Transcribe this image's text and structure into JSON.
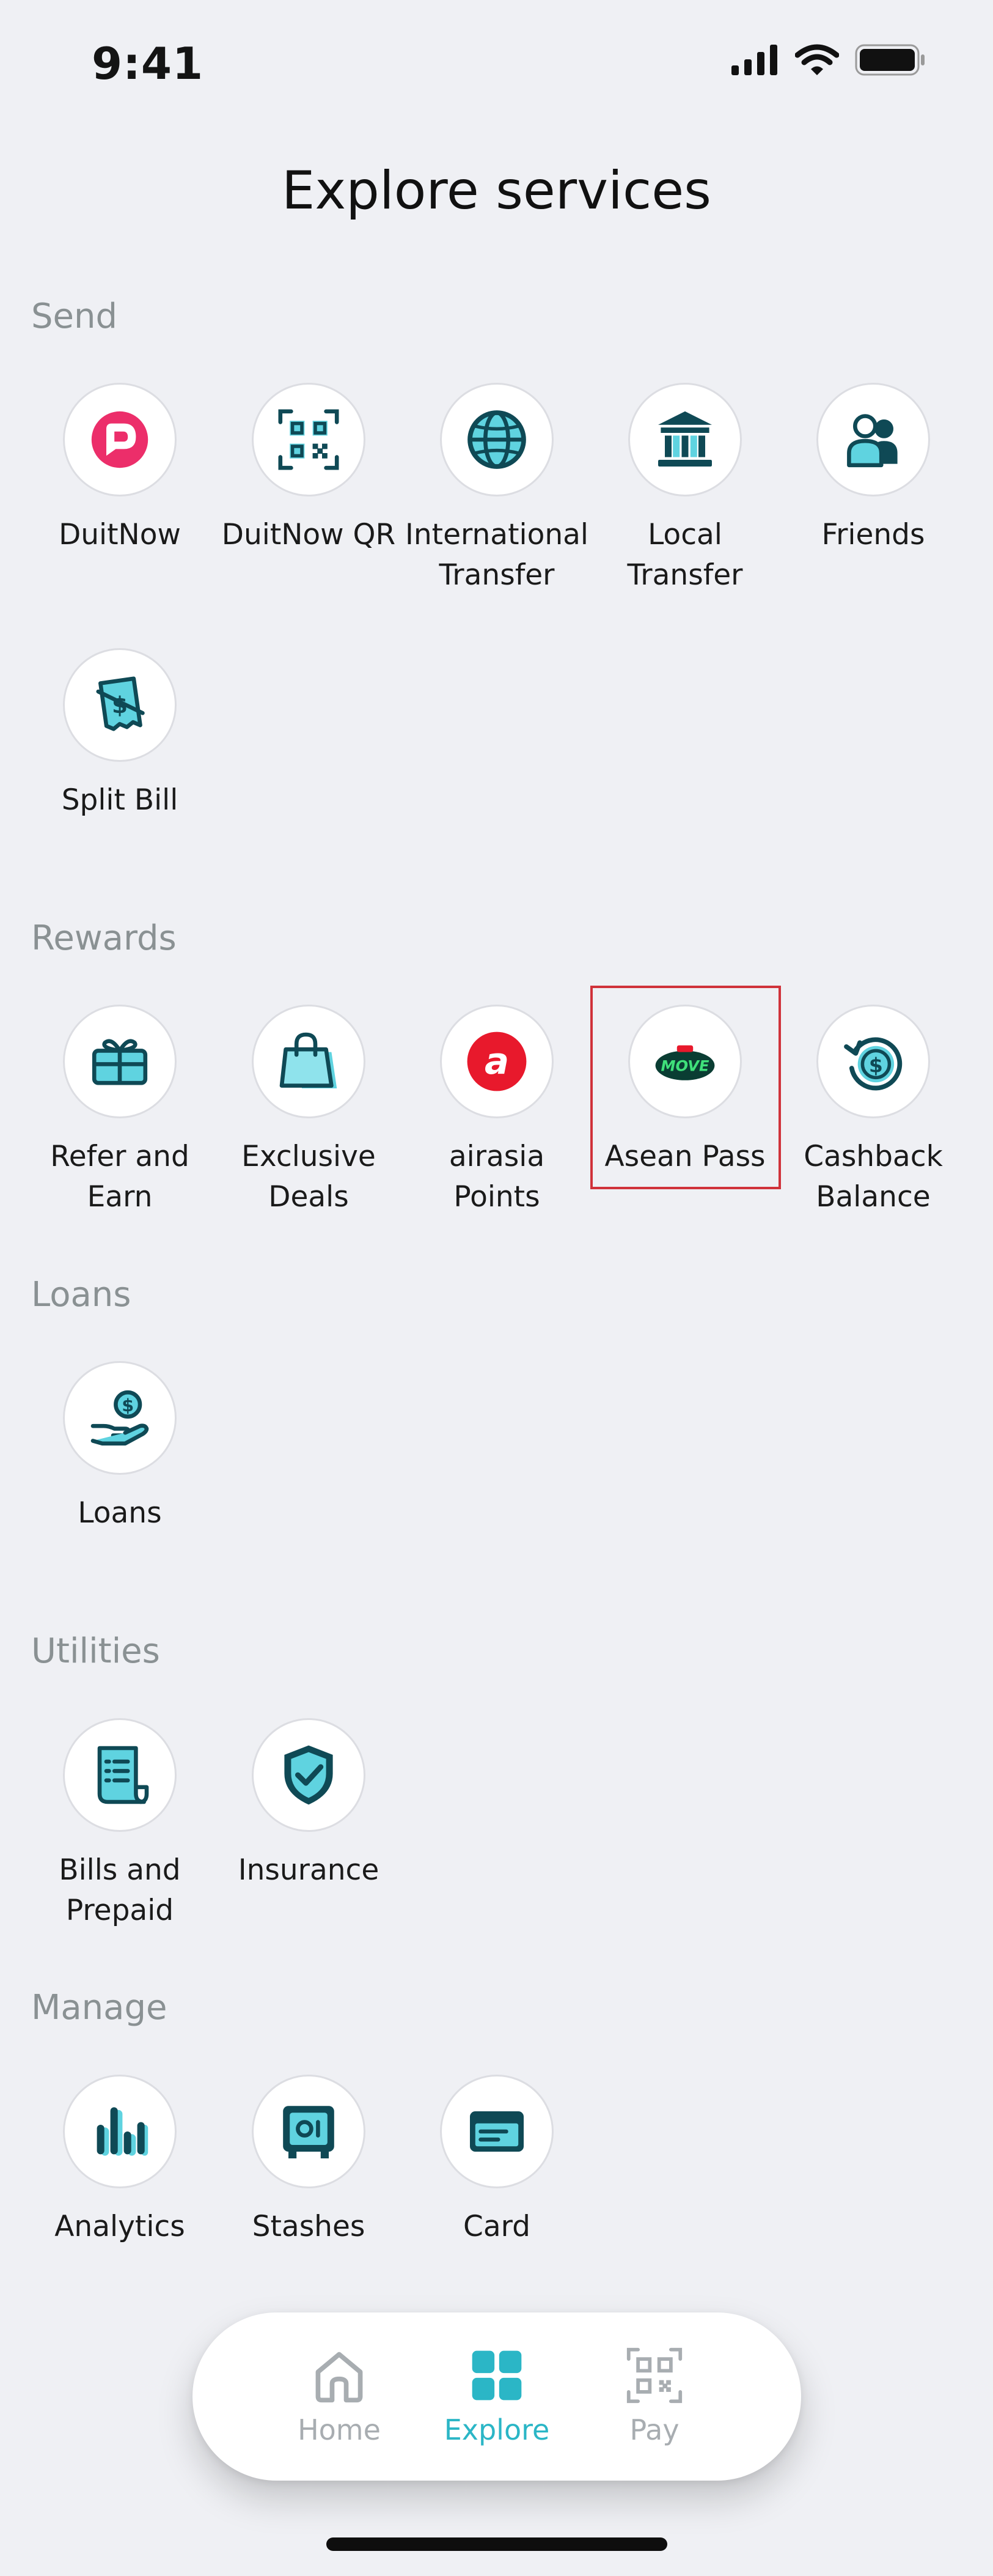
{
  "status_bar": {
    "time": "9:41"
  },
  "page": {
    "title": "Explore services"
  },
  "sections": {
    "send": {
      "title": "Send",
      "items": [
        {
          "label": "DuitNow",
          "icon": "duitnow-icon"
        },
        {
          "label": "DuitNow QR",
          "icon": "qr-code-icon"
        },
        {
          "label": "International Transfer",
          "icon": "globe-icon"
        },
        {
          "label": "Local Transfer",
          "icon": "bank-icon"
        },
        {
          "label": "Friends",
          "icon": "friends-icon"
        },
        {
          "label": "Split Bill",
          "icon": "split-bill-icon"
        }
      ]
    },
    "rewards": {
      "title": "Rewards",
      "items": [
        {
          "label": "Refer and Earn",
          "icon": "gift-card-icon"
        },
        {
          "label": "Exclusive Deals",
          "icon": "shopping-bag-icon"
        },
        {
          "label": "airasia Points",
          "icon": "airasia-icon"
        },
        {
          "label": "Asean Pass",
          "icon": "move-logo-icon",
          "logo_text": "MOVE"
        },
        {
          "label": "Cashback Balance",
          "icon": "cashback-icon"
        }
      ]
    },
    "loans": {
      "title": "Loans",
      "items": [
        {
          "label": "Loans",
          "icon": "hand-coin-icon"
        }
      ]
    },
    "utilities": {
      "title": "Utilities",
      "items": [
        {
          "label": "Bills and Prepaid",
          "icon": "receipt-icon"
        },
        {
          "label": "Insurance",
          "icon": "shield-check-icon"
        }
      ]
    },
    "manage": {
      "title": "Manage",
      "items": [
        {
          "label": "Analytics",
          "icon": "bar-chart-icon"
        },
        {
          "label": "Stashes",
          "icon": "safe-icon"
        },
        {
          "label": "Card",
          "icon": "card-icon"
        }
      ]
    }
  },
  "bottom_nav": {
    "items": [
      {
        "label": "Home",
        "icon": "home-icon",
        "active": false
      },
      {
        "label": "Explore",
        "icon": "grid-icon",
        "active": true
      },
      {
        "label": "Pay",
        "icon": "scan-qr-icon",
        "active": false
      }
    ]
  },
  "colors": {
    "background": "#eff0f4",
    "accent": "#2bb6c6",
    "icon_dark": "#0f4955",
    "icon_light": "#5fd3e0",
    "brand_red": "#e8192c",
    "highlight": "#d0323a",
    "section_title": "#8a9193"
  }
}
